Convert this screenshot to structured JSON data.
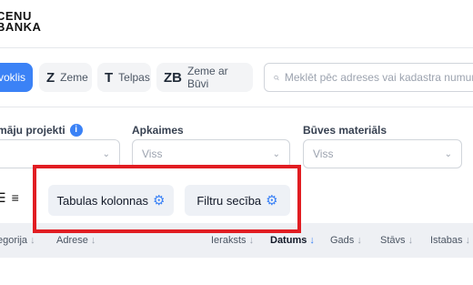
{
  "logo": {
    "line1": "CENU",
    "line2": "BANKA"
  },
  "tabs": [
    {
      "label": "voklis",
      "icon": ""
    },
    {
      "label": "Zeme",
      "icon": "Z"
    },
    {
      "label": "Telpas",
      "icon": "T"
    },
    {
      "label": "Zeme ar Būvi",
      "icon": "ZB"
    }
  ],
  "search": {
    "placeholder": "Meklēt pēc adreses vai kadastra numura"
  },
  "filters": [
    {
      "label": "māju projekti",
      "value": ""
    },
    {
      "label": "Apkaimes",
      "value": "Viss"
    },
    {
      "label": "Būves materiāls",
      "value": "Viss"
    }
  ],
  "toolbar": {
    "columns_label": "Tabulas kolonnas",
    "filter_order_label": "Filtru secība"
  },
  "table": {
    "headers": [
      {
        "label": "egorija",
        "arrow": "↓"
      },
      {
        "label": "Adrese",
        "arrow": "↓"
      },
      {
        "label": "Ieraksts",
        "arrow": "↓"
      },
      {
        "label": "Datums",
        "arrow": "↓",
        "active": true
      },
      {
        "label": "Gads",
        "arrow": "↓"
      },
      {
        "label": "Stāvs",
        "arrow": "↓"
      },
      {
        "label": "Istabas",
        "arrow": "↓"
      }
    ]
  },
  "colors": {
    "accent": "#3b82f6",
    "highlight": "#e11d22"
  }
}
